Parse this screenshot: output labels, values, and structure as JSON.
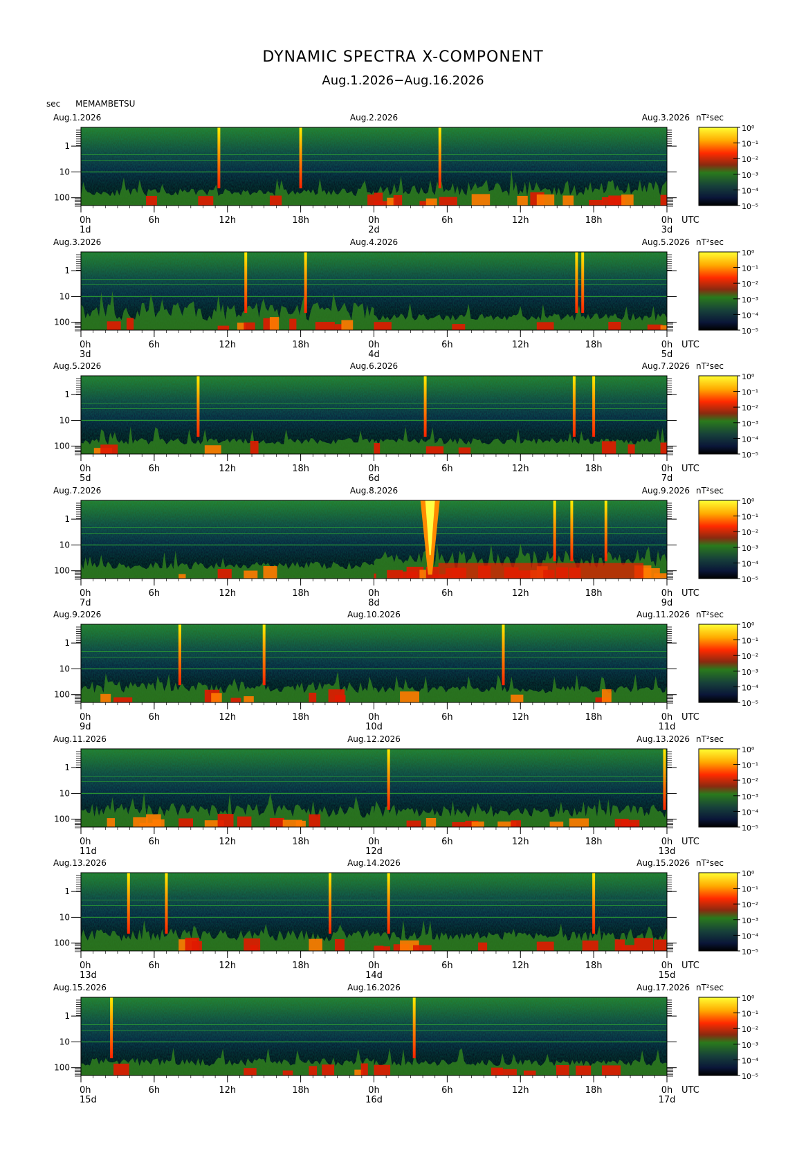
{
  "title": "DYNAMIC SPECTRA X-COMPONENT",
  "subtitle": "Aug.1.2026−Aug.16.2026",
  "units_label": "sec",
  "station": "MEMAMBETSU",
  "chart_data": {
    "type": "heatmap",
    "y_ticks": [
      "1",
      "10",
      "100"
    ],
    "x_ticks": [
      "0h",
      "6h",
      "12h",
      "18h",
      "0h",
      "6h",
      "12h",
      "18h",
      "0h"
    ],
    "utc_label": "UTC",
    "colorbar": {
      "unit_label": "nT²sec",
      "ticks": [
        "10⁰",
        "10⁻¹",
        "10⁻²",
        "10⁻³",
        "10⁻⁴",
        "10⁻⁵"
      ],
      "colors": [
        "#ffff00",
        "#ff9900",
        "#ff2200",
        "#cc2200",
        "#2a7a1c",
        "#1c4a2a",
        "#0c1530",
        "#000000"
      ]
    },
    "panels": [
      {
        "start": "Aug.1.2026",
        "mid": "Aug.2.2026",
        "end": "Aug.3.2026",
        "day_labels": [
          "1d",
          "2d",
          "3d"
        ],
        "spikes": [
          11.3,
          18.0,
          29.4
        ],
        "storm": [],
        "low_activity": 0.35,
        "high_activity": 0.75
      },
      {
        "start": "Aug.3.2026",
        "mid": "Aug.4.2026",
        "end": "Aug.5.2026",
        "day_labels": [
          "3d",
          "4d",
          "5d"
        ],
        "spikes": [
          13.5,
          18.4,
          40.6,
          41.1
        ],
        "storm": [],
        "low_activity": 0.85,
        "high_activity": 0.35
      },
      {
        "start": "Aug.5.2026",
        "mid": "Aug.6.2026",
        "end": "Aug.7.2026",
        "day_labels": [
          "5d",
          "6d",
          "7d"
        ],
        "spikes": [
          9.6,
          28.2,
          40.4,
          42.0
        ],
        "storm": [],
        "low_activity": 0.3,
        "high_activity": 0.3
      },
      {
        "start": "Aug.7.2026",
        "mid": "Aug.8.2026",
        "end": "Aug.9.2026",
        "day_labels": [
          "7d",
          "8d",
          "9d"
        ],
        "spikes": [
          38.8,
          40.2,
          43.0
        ],
        "storm": [
          28.6
        ],
        "low_activity": 0.35,
        "high_activity": 0.9
      },
      {
        "start": "Aug.9.2026",
        "mid": "Aug.10.2026",
        "end": "Aug.11.2026",
        "day_labels": [
          "9d",
          "10d",
          "11d"
        ],
        "spikes": [
          8.1,
          15.0,
          34.6
        ],
        "storm": [],
        "low_activity": 0.55,
        "high_activity": 0.35
      },
      {
        "start": "Aug.11.2026",
        "mid": "Aug.12.2026",
        "end": "Aug.13.2026",
        "day_labels": [
          "11d",
          "12d",
          "13d"
        ],
        "spikes": [
          25.2,
          47.8
        ],
        "storm": [],
        "low_activity": 0.65,
        "high_activity": 0.6
      },
      {
        "start": "Aug.13.2026",
        "mid": "Aug.14.2026",
        "end": "Aug.15.2026",
        "day_labels": [
          "13d",
          "14d",
          "15d"
        ],
        "spikes": [
          3.9,
          7.0,
          20.4,
          25.2,
          42.0
        ],
        "storm": [],
        "low_activity": 0.55,
        "high_activity": 0.45
      },
      {
        "start": "Aug.15.2026",
        "mid": "Aug.16.2026",
        "end": "Aug.17.2026",
        "day_labels": [
          "15d",
          "16d",
          "17d"
        ],
        "spikes": [
          2.5,
          27.3
        ],
        "storm": [],
        "low_activity": 0.4,
        "high_activity": 0.3
      }
    ]
  }
}
